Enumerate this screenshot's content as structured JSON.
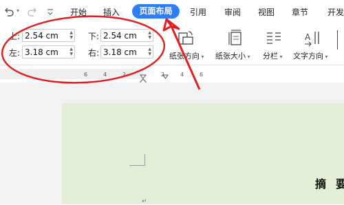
{
  "quick_access": {
    "undo_icon": "undo-icon",
    "redo_icon": "redo-icon",
    "customize_icon": "chevron-down-icon"
  },
  "tabs": {
    "start": "开始",
    "insert": "插入",
    "page_layout": "页面布局",
    "references": "引用",
    "review": "审阅",
    "view": "视图",
    "chapter": "章节",
    "developer": "开发"
  },
  "margins": {
    "top_label": "上:",
    "top_value": "2.54 cm",
    "bottom_label": "下:",
    "bottom_value": "2.54 cm",
    "left_label": "左:",
    "left_value": "3.18 cm",
    "right_label": "右:",
    "right_value": "3.18 cm"
  },
  "tools": {
    "orientation": "纸张方向",
    "size": "纸张大小",
    "columns": "分栏",
    "text_direction": "文字方向"
  },
  "ruler": {
    "numbers": [
      "6",
      "4",
      "2",
      "2",
      "4",
      "6"
    ]
  },
  "document": {
    "heading_char_1": "摘",
    "heading_char_2": "要"
  },
  "colors": {
    "accent": "#2f7df6",
    "annotation": "#e02020",
    "page_background": "#e3eed9"
  }
}
